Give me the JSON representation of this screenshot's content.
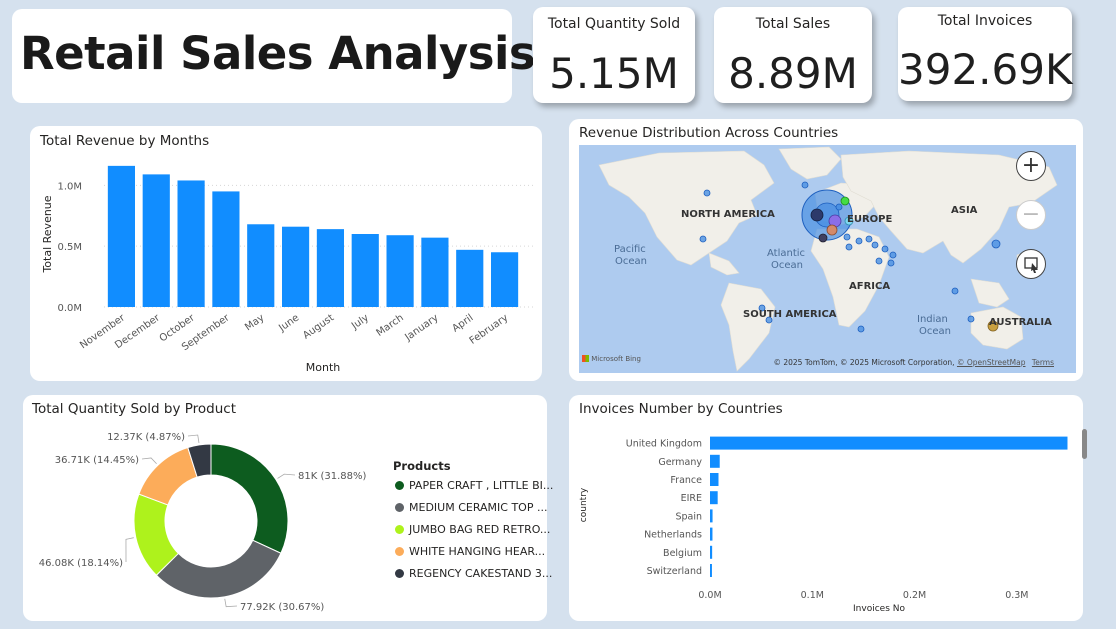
{
  "header": {
    "title": "Retail Sales Analysis"
  },
  "kpis": [
    {
      "label": "Total Quantity Sold",
      "value": "5.15M"
    },
    {
      "label": "Total Sales",
      "value": "8.89M"
    },
    {
      "label": "Total Invoices",
      "value": "392.69K"
    }
  ],
  "revenue_chart": {
    "title": "Total Revenue by Months"
  },
  "map": {
    "title": "Revenue Distribution Across Countries",
    "labels": {
      "north_america": "NORTH AMERICA",
      "europe": "EUROPE",
      "asia": "ASIA",
      "africa": "AFRICA",
      "south_america": "SOUTH AMERICA",
      "australia": "AUSTRALIA",
      "pacific": "Pacific",
      "pacific2": "Ocean",
      "atlantic": "Atlantic",
      "atlantic2": "Ocean",
      "indian": "Indian",
      "indian2": "Ocean"
    },
    "bing": "Microsoft Bing",
    "attribution": "© 2025 TomTom, © 2025 Microsoft Corporation,",
    "osm": "© OpenStreetMap",
    "terms": "Terms"
  },
  "donut_chart": {
    "title": "Total Quantity Sold by Product",
    "legend_title": "Products"
  },
  "invoice_chart": {
    "title": "Invoices Number by Countries"
  },
  "colors": {
    "bar": "#118dff",
    "background": "#d5e1ee"
  },
  "chart_data": [
    {
      "type": "bar",
      "title": "Total Revenue by Months",
      "xlabel": "Month",
      "ylabel": "Total Revenue",
      "categories": [
        "November",
        "December",
        "October",
        "September",
        "May",
        "June",
        "August",
        "July",
        "March",
        "January",
        "April",
        "February"
      ],
      "values": [
        1.16,
        1.09,
        1.04,
        0.95,
        0.68,
        0.66,
        0.64,
        0.6,
        0.59,
        0.57,
        0.47,
        0.45
      ],
      "value_unit": "M",
      "yticks": [
        "0.0M",
        "0.5M",
        "1.0M"
      ],
      "ylim": [
        0,
        1.2
      ],
      "grid": true
    },
    {
      "type": "pie",
      "title": "Total Quantity Sold by Product",
      "legend_title": "Products",
      "slices": [
        {
          "name": "PAPER CRAFT , LITTLE BI...",
          "value": 81,
          "label": "81K (31.88%)",
          "color": "#0d5c1f"
        },
        {
          "name": "MEDIUM CERAMIC TOP ...",
          "value": 77.92,
          "label": "77.92K (30.67%)",
          "color": "#5f6368"
        },
        {
          "name": "JUMBO BAG RED RETRO...",
          "value": 46.08,
          "label": "46.08K (18.14%)",
          "color": "#aef21c"
        },
        {
          "name": "WHITE HANGING HEAR...",
          "value": 36.71,
          "label": "36.71K (14.45%)",
          "color": "#fcac5a"
        },
        {
          "name": "REGENCY CAKESTAND 3...",
          "value": 12.37,
          "label": "12.37K (4.87%)",
          "color": "#333944"
        }
      ],
      "legend_placement": "right"
    },
    {
      "type": "bar",
      "orientation": "horizontal",
      "title": "Invoices Number by Countries",
      "xlabel": "Invoices No",
      "ylabel": "country",
      "categories": [
        "United Kingdom",
        "Germany",
        "France",
        "EIRE",
        "Spain",
        "Netherlands",
        "Belgium",
        "Switzerland"
      ],
      "values": [
        0.3495,
        0.0095,
        0.0083,
        0.0075,
        0.0025,
        0.0024,
        0.0021,
        0.0019
      ],
      "value_unit": "M",
      "xticks": [
        "0.0M",
        "0.1M",
        "0.2M",
        "0.3M"
      ],
      "xlim": [
        0,
        0.35
      ]
    }
  ]
}
